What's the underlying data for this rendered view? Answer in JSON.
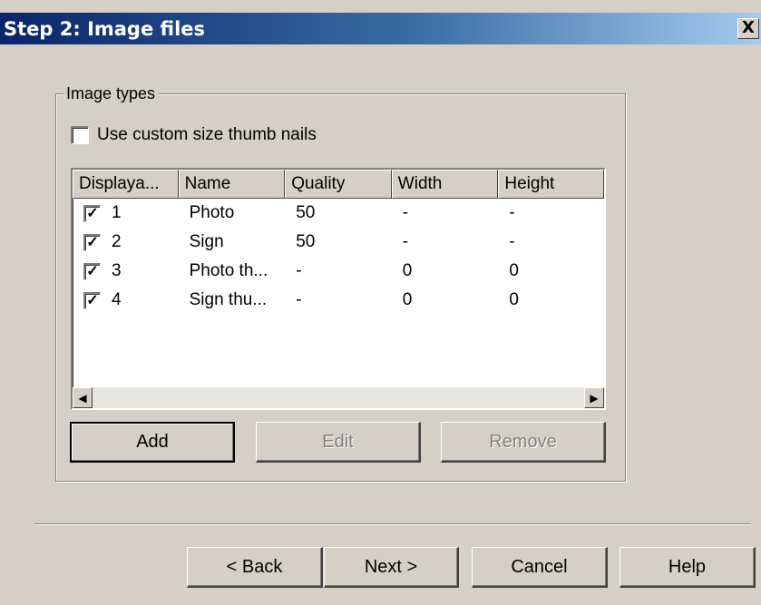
{
  "window": {
    "title": "Step 2: Image files",
    "close_glyph": "X"
  },
  "image_types": {
    "group_label": "Image types",
    "custom_thumbs": {
      "label": "Use custom size thumb nails",
      "checked": false
    },
    "columns": [
      "Displaya...",
      "Name",
      "Quality",
      "Width",
      "Height"
    ],
    "rows": [
      {
        "checked": true,
        "display": "1",
        "name": "Photo",
        "quality": "50",
        "width": "-",
        "height": "-"
      },
      {
        "checked": true,
        "display": "2",
        "name": "Sign",
        "quality": "50",
        "width": "-",
        "height": "-"
      },
      {
        "checked": true,
        "display": "3",
        "name": "Photo th...",
        "quality": "-",
        "width": "0",
        "height": "0"
      },
      {
        "checked": true,
        "display": "4",
        "name": "Sign thu...",
        "quality": "-",
        "width": "0",
        "height": "0"
      }
    ],
    "buttons": {
      "add": "Add",
      "edit": "Edit",
      "remove": "Remove"
    }
  },
  "footer": {
    "back": "< Back",
    "next": "Next >",
    "cancel": "Cancel",
    "help": "Help"
  },
  "icons": {
    "close": "close-icon",
    "check": "checkmark-icon",
    "scroll_left": "arrow-left-icon",
    "scroll_right": "arrow-right-icon"
  }
}
